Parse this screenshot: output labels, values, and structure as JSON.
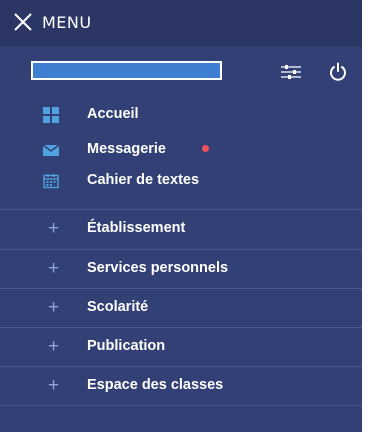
{
  "header": {
    "title": "MENU"
  },
  "colors": {
    "background": "#334075",
    "header_background": "#2b3665",
    "user_bar": "#3f7fd2",
    "icon_accent": "#4fa3e0",
    "notification": "#f0545a",
    "plus": "#8fa3d9"
  },
  "nav": {
    "items": [
      {
        "label": "Accueil",
        "icon": "grid-icon"
      },
      {
        "label": "Messagerie",
        "icon": "envelope-icon",
        "has_notification": true
      },
      {
        "label": "Cahier de textes",
        "icon": "calendar-icon"
      }
    ]
  },
  "sections": [
    {
      "label": "Établissement"
    },
    {
      "label": "Services personnels"
    },
    {
      "label": "Scolarité"
    },
    {
      "label": "Publication"
    },
    {
      "label": "Espace des classes"
    }
  ]
}
